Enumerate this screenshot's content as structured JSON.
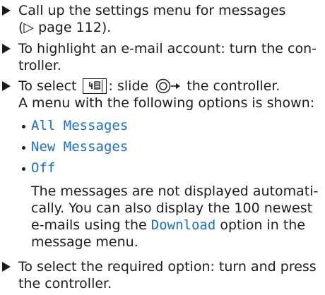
{
  "steps": [
    {
      "line1": "Call up the settings menu for messages",
      "line2": "(▷ page 112)."
    },
    {
      "line1": "To highlight an e-mail account: turn the con-",
      "line2": "troller."
    },
    {
      "prefix": "To select",
      "mid": ": slide",
      "suffix": "the controller.",
      "line2": "A menu with the following options is shown:",
      "icon": "menu-icon",
      "slide_icon": "controller-slide-right-icon"
    }
  ],
  "options": [
    "All Messages",
    "New Messages",
    "Off"
  ],
  "off_description": {
    "line1": "The messages are not displayed automati-",
    "line2": "cally. You can also display the 100 newest",
    "line3_pre": "e-mails using the",
    "line3_keyword": "Download",
    "line3_post": "option in the",
    "line4": "message menu."
  },
  "final_step": {
    "line1": "To select the required option: turn and press",
    "line2": "the controller."
  },
  "colors": {
    "accent": "#1a6fc2",
    "text": "#1c1c1c"
  }
}
